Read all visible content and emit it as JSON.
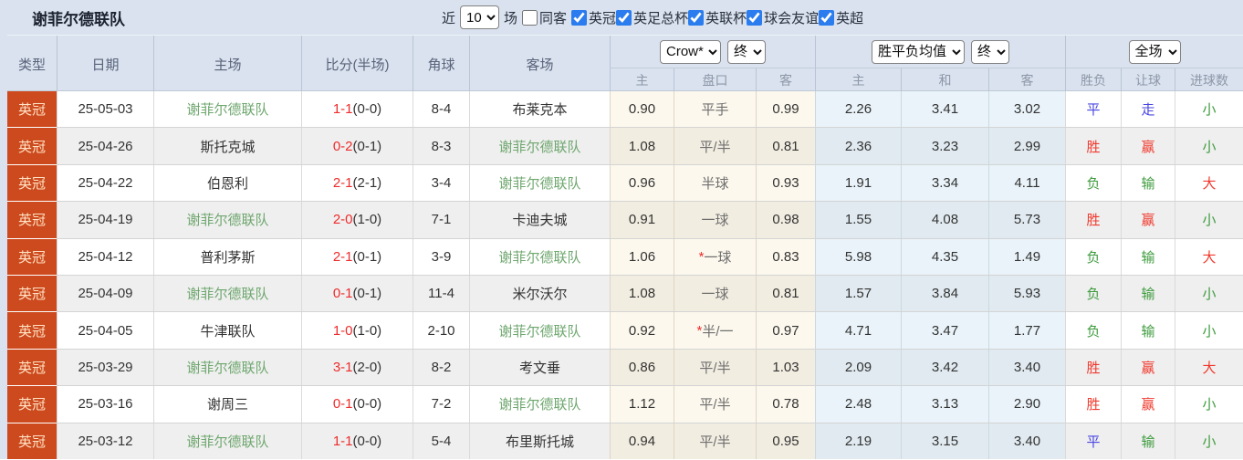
{
  "colors": {
    "page_background": "#d9e2ee",
    "type_badge_bg": "#cd4a1e",
    "type_badge_text": "#ffe2c4",
    "team_highlight_green": "#6fa76f",
    "score_red": "#ee2c2c",
    "result_win_red": "#f03a2e",
    "result_draw_blue": "#4a46e2",
    "result_lose_green": "#3e9b3e",
    "handicap_col_bg": "#fcf8ed",
    "avg_col_bg": "#e9f3f9",
    "checkbox_accent": "#2b7cee"
  },
  "toolbar": {
    "title": "谢菲尔德联队",
    "recent_label": "近",
    "recent_count": "10",
    "matches_label": "场",
    "same_venue_label": "同客",
    "same_venue_checked": false,
    "league_filters": [
      {
        "label": "英冠",
        "checked": true
      },
      {
        "label": "英足总杯",
        "checked": true
      },
      {
        "label": "英联杯",
        "checked": true
      },
      {
        "label": "球会友谊",
        "checked": true
      },
      {
        "label": "英超",
        "checked": true
      }
    ]
  },
  "table": {
    "header": {
      "type": "类型",
      "date": "日期",
      "home": "主场",
      "score": "比分(半场)",
      "corner": "角球",
      "away": "客场",
      "odds_source_select": "Crow*",
      "odds_time_select": "终",
      "odds_sub": [
        "主",
        "盘口",
        "客"
      ],
      "avg_select": "胜平负均值",
      "avg_time_select": "终",
      "avg_sub": [
        "主",
        "和",
        "客"
      ],
      "scope_select": "全场",
      "result_sub": [
        "胜负",
        "让球",
        "进球数"
      ]
    },
    "rows": [
      {
        "type": "英冠",
        "date": "25-05-03",
        "home": "谢菲尔德联队",
        "home_hl": true,
        "score_ft": "1-1",
        "score_ht": "(0-0)",
        "corner": "8-4",
        "away": "布莱克本",
        "away_hl": false,
        "odds_home": "0.90",
        "handicap": "平手",
        "handicap_star": false,
        "odds_away": "0.99",
        "avg_home": "2.26",
        "avg_draw": "3.41",
        "avg_away": "3.02",
        "result": "平",
        "result_cls": "blue",
        "handicap_result": "走",
        "handicap_result_cls": "blue",
        "goals": "小",
        "goals_cls": "green"
      },
      {
        "type": "英冠",
        "date": "25-04-26",
        "home": "斯托克城",
        "home_hl": false,
        "score_ft": "0-2",
        "score_ht": "(0-1)",
        "corner": "8-3",
        "away": "谢菲尔德联队",
        "away_hl": true,
        "odds_home": "1.08",
        "handicap": "平/半",
        "handicap_star": false,
        "odds_away": "0.81",
        "avg_home": "2.36",
        "avg_draw": "3.23",
        "avg_away": "2.99",
        "result": "胜",
        "result_cls": "red",
        "handicap_result": "赢",
        "handicap_result_cls": "red",
        "goals": "小",
        "goals_cls": "green"
      },
      {
        "type": "英冠",
        "date": "25-04-22",
        "home": "伯恩利",
        "home_hl": false,
        "score_ft": "2-1",
        "score_ht": "(2-1)",
        "corner": "3-4",
        "away": "谢菲尔德联队",
        "away_hl": true,
        "odds_home": "0.96",
        "handicap": "半球",
        "handicap_star": false,
        "odds_away": "0.93",
        "avg_home": "1.91",
        "avg_draw": "3.34",
        "avg_away": "4.11",
        "result": "负",
        "result_cls": "green",
        "handicap_result": "输",
        "handicap_result_cls": "green",
        "goals": "大",
        "goals_cls": "red"
      },
      {
        "type": "英冠",
        "date": "25-04-19",
        "home": "谢菲尔德联队",
        "home_hl": true,
        "score_ft": "2-0",
        "score_ht": "(1-0)",
        "corner": "7-1",
        "away": "卡迪夫城",
        "away_hl": false,
        "odds_home": "0.91",
        "handicap": "一球",
        "handicap_star": false,
        "odds_away": "0.98",
        "avg_home": "1.55",
        "avg_draw": "4.08",
        "avg_away": "5.73",
        "result": "胜",
        "result_cls": "red",
        "handicap_result": "赢",
        "handicap_result_cls": "red",
        "goals": "小",
        "goals_cls": "green"
      },
      {
        "type": "英冠",
        "date": "25-04-12",
        "home": "普利茅斯",
        "home_hl": false,
        "score_ft": "2-1",
        "score_ht": "(0-1)",
        "corner": "3-9",
        "away": "谢菲尔德联队",
        "away_hl": true,
        "odds_home": "1.06",
        "handicap": "一球",
        "handicap_star": true,
        "odds_away": "0.83",
        "avg_home": "5.98",
        "avg_draw": "4.35",
        "avg_away": "1.49",
        "result": "负",
        "result_cls": "green",
        "handicap_result": "输",
        "handicap_result_cls": "green",
        "goals": "大",
        "goals_cls": "red"
      },
      {
        "type": "英冠",
        "date": "25-04-09",
        "home": "谢菲尔德联队",
        "home_hl": true,
        "score_ft": "0-1",
        "score_ht": "(0-1)",
        "corner": "11-4",
        "away": "米尔沃尔",
        "away_hl": false,
        "odds_home": "1.08",
        "handicap": "一球",
        "handicap_star": false,
        "odds_away": "0.81",
        "avg_home": "1.57",
        "avg_draw": "3.84",
        "avg_away": "5.93",
        "result": "负",
        "result_cls": "green",
        "handicap_result": "输",
        "handicap_result_cls": "green",
        "goals": "小",
        "goals_cls": "green"
      },
      {
        "type": "英冠",
        "date": "25-04-05",
        "home": "牛津联队",
        "home_hl": false,
        "score_ft": "1-0",
        "score_ht": "(1-0)",
        "corner": "2-10",
        "away": "谢菲尔德联队",
        "away_hl": true,
        "odds_home": "0.92",
        "handicap": "半/一",
        "handicap_star": true,
        "odds_away": "0.97",
        "avg_home": "4.71",
        "avg_draw": "3.47",
        "avg_away": "1.77",
        "result": "负",
        "result_cls": "green",
        "handicap_result": "输",
        "handicap_result_cls": "green",
        "goals": "小",
        "goals_cls": "green"
      },
      {
        "type": "英冠",
        "date": "25-03-29",
        "home": "谢菲尔德联队",
        "home_hl": true,
        "score_ft": "3-1",
        "score_ht": "(2-0)",
        "corner": "8-2",
        "away": "考文垂",
        "away_hl": false,
        "odds_home": "0.86",
        "handicap": "平/半",
        "handicap_star": false,
        "odds_away": "1.03",
        "avg_home": "2.09",
        "avg_draw": "3.42",
        "avg_away": "3.40",
        "result": "胜",
        "result_cls": "red",
        "handicap_result": "赢",
        "handicap_result_cls": "red",
        "goals": "大",
        "goals_cls": "red"
      },
      {
        "type": "英冠",
        "date": "25-03-16",
        "home": "谢周三",
        "home_hl": false,
        "score_ft": "0-1",
        "score_ht": "(0-0)",
        "corner": "7-2",
        "away": "谢菲尔德联队",
        "away_hl": true,
        "odds_home": "1.12",
        "handicap": "平/半",
        "handicap_star": false,
        "odds_away": "0.78",
        "avg_home": "2.48",
        "avg_draw": "3.13",
        "avg_away": "2.90",
        "result": "胜",
        "result_cls": "red",
        "handicap_result": "赢",
        "handicap_result_cls": "red",
        "goals": "小",
        "goals_cls": "green"
      },
      {
        "type": "英冠",
        "date": "25-03-12",
        "home": "谢菲尔德联队",
        "home_hl": true,
        "score_ft": "1-1",
        "score_ht": "(0-0)",
        "corner": "5-4",
        "away": "布里斯托城",
        "away_hl": false,
        "odds_home": "0.94",
        "handicap": "平/半",
        "handicap_star": false,
        "odds_away": "0.95",
        "avg_home": "2.19",
        "avg_draw": "3.15",
        "avg_away": "3.40",
        "result": "平",
        "result_cls": "blue",
        "handicap_result": "输",
        "handicap_result_cls": "green",
        "goals": "小",
        "goals_cls": "green"
      }
    ]
  }
}
